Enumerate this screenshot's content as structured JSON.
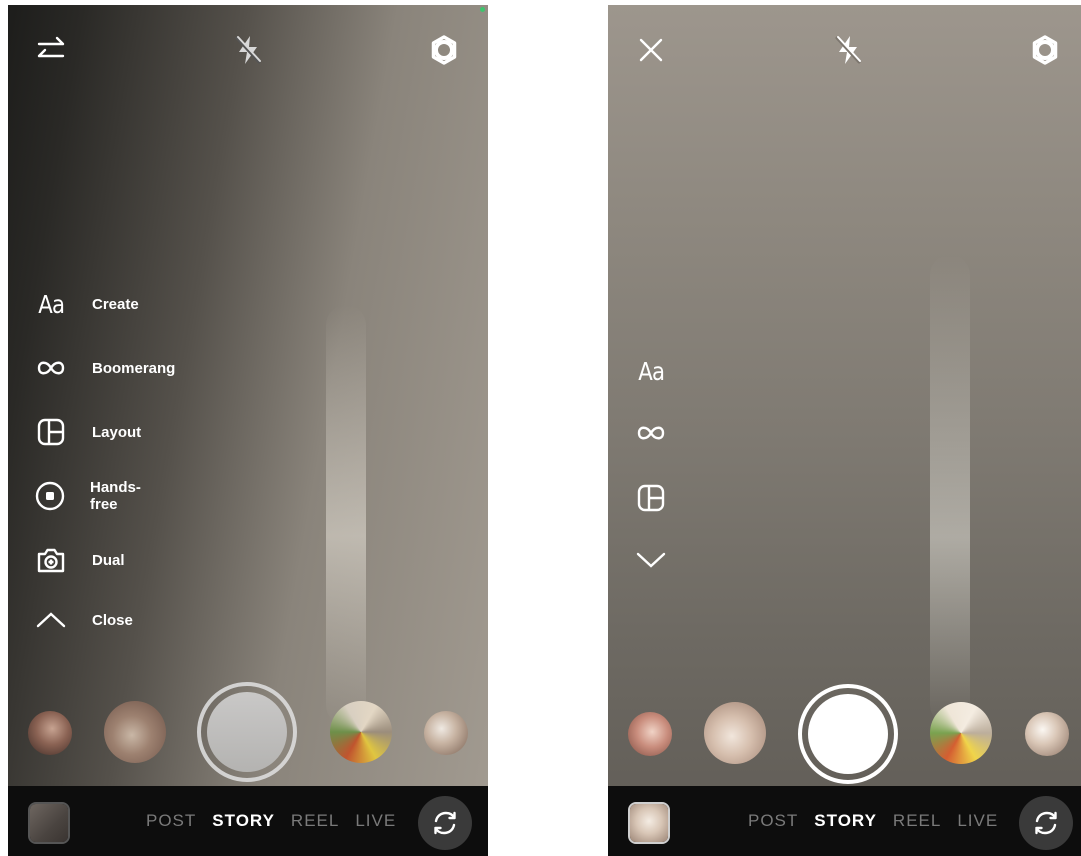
{
  "left": {
    "menu": [
      {
        "label": "Create"
      },
      {
        "label": "Boomerang"
      },
      {
        "label": "Layout"
      },
      {
        "label": "Hands-free"
      },
      {
        "label": "Dual"
      },
      {
        "label": "Close"
      }
    ],
    "modes": [
      {
        "label": "POST"
      },
      {
        "label": "STORY"
      },
      {
        "label": "REEL"
      },
      {
        "label": "LIVE"
      }
    ]
  },
  "right": {
    "menu": [
      {
        "label": "Aa"
      }
    ],
    "modes": [
      {
        "label": "POST"
      },
      {
        "label": "STORY"
      },
      {
        "label": "REEL"
      },
      {
        "label": "LIVE"
      }
    ]
  },
  "icons": {
    "left_top": [
      "swap-arrows-icon",
      "flash-off-icon",
      "settings-icon"
    ],
    "right_top": [
      "close-icon",
      "flash-off-icon",
      "settings-icon"
    ],
    "left_menu": [
      "create-text-icon",
      "boomerang-icon",
      "layout-icon",
      "hands-free-icon",
      "dual-camera-icon",
      "chevron-up-icon"
    ],
    "right_menu": [
      "create-text-icon",
      "boomerang-icon",
      "layout-icon",
      "chevron-down-icon"
    ],
    "bottom": [
      "gallery-thumbnail",
      "flip-camera-icon"
    ]
  },
  "colors": {
    "bar": "#0d0d0d",
    "active_mode": "#ffffff",
    "inactive_mode": "#7a7a7a",
    "status_dot": "#3ec46d"
  }
}
